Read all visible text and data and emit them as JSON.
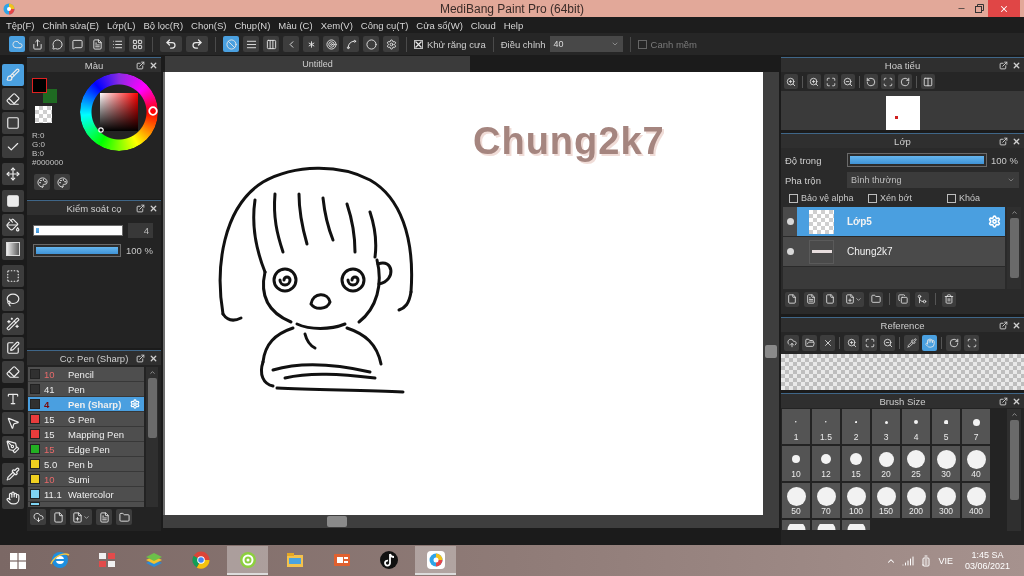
{
  "window": {
    "title": "MediBang Paint Pro (64bit)"
  },
  "menu": [
    "Tệp(F)",
    "Chỉnh sửa(E)",
    "Lớp(L)",
    "Bộ lọc(R)",
    "Chọn(S)",
    "Chụp(N)",
    "Màu (C)",
    "Xem(V)",
    "Công cụ(T)",
    "Cửa sổ(W)",
    "Cloud",
    "Help"
  ],
  "toolbar": {
    "file_buttons": [
      {
        "selected": true
      },
      {
        "selected": false
      },
      {
        "selected": false
      },
      {
        "selected": false
      },
      {
        "selected": false
      },
      {
        "selected": false
      },
      {
        "selected": false
      }
    ],
    "snap_buttons": [
      {
        "selected": true
      },
      {
        "selected": false
      },
      {
        "selected": false
      },
      {
        "selected": false
      },
      {
        "selected": false
      },
      {
        "selected": false
      },
      {
        "selected": false
      },
      {
        "selected": false
      },
      {
        "selected": false
      }
    ],
    "antialias": {
      "label": "Khử răng cưa",
      "checked": true
    },
    "correction": {
      "label": "Điều chỉnh",
      "value": "40"
    },
    "soft_edge": {
      "label": "Canh mềm",
      "checked": false,
      "disabled": true
    }
  },
  "tool_groups": [
    {
      "tools": [
        {
          "selected": true
        },
        {
          "selected": false
        },
        {
          "selected": false
        },
        {
          "selected": false
        }
      ]
    },
    {
      "tools": [
        {
          "selected": false
        }
      ]
    },
    {
      "tools": [
        {
          "selected": false
        },
        {
          "selected": false
        },
        {
          "selected": false
        }
      ]
    },
    {
      "tools": [
        {
          "selected": false
        },
        {
          "selected": false
        },
        {
          "selected": false
        },
        {
          "selected": false
        },
        {
          "selected": false
        }
      ]
    },
    {
      "tools": [
        {
          "selected": false
        },
        {
          "selected": false
        },
        {
          "selected": false
        }
      ]
    },
    {
      "tools": [
        {
          "selected": false
        },
        {
          "selected": false
        }
      ]
    }
  ],
  "color_panel": {
    "title": "Màu",
    "swatches": [
      {
        "color": "#000000"
      },
      {
        "color": "#1f6a22"
      }
    ],
    "channels": [
      "R:0",
      "G:0",
      "B:0"
    ],
    "hex": "#000000"
  },
  "brush_control": {
    "title": "Kiểm soát cọ",
    "size": {
      "level": 0.03,
      "value": "4"
    },
    "opacity": {
      "level": 1,
      "reading": "100 %"
    }
  },
  "brush_panel": {
    "title": "Cọ: Pen (Sharp)",
    "brushes": [
      {
        "color": "#303030",
        "size": {
          "value": "10",
          "highlighted": true
        },
        "name": "Pencil",
        "selected": false
      },
      {
        "color": "#303030",
        "size": {
          "value": "41",
          "highlighted": false
        },
        "name": "Pen",
        "selected": false
      },
      {
        "color": "#303030",
        "size": {
          "value": "4",
          "highlighted": true
        },
        "name": "Pen (Sharp)",
        "selected": true
      },
      {
        "color": "#e83c3c",
        "size": {
          "value": "15",
          "highlighted": false
        },
        "name": "G Pen",
        "selected": false
      },
      {
        "color": "#e83c3c",
        "size": {
          "value": "15",
          "highlighted": false
        },
        "name": "Mapping Pen",
        "selected": false
      },
      {
        "color": "#22b022",
        "size": {
          "value": "15",
          "highlighted": true
        },
        "name": "Edge Pen",
        "selected": false
      },
      {
        "color": "#f0d020",
        "size": {
          "value": "5.0",
          "highlighted": false
        },
        "name": "Pen b",
        "selected": false
      },
      {
        "color": "#f0d020",
        "size": {
          "value": "10",
          "highlighted": true
        },
        "name": "Sumi",
        "selected": false
      },
      {
        "color": "#7fd4f4",
        "size": {
          "value": "11.1",
          "highlighted": false
        },
        "name": "Watercolor",
        "selected": false
      }
    ],
    "cut_row": {
      "color": "#7fd4f4"
    }
  },
  "canvas": {
    "tab": "Untitled",
    "text": "Chung2k7"
  },
  "navigator": {
    "title": "Hoa tiểu"
  },
  "layers_panel": {
    "title": "Lớp",
    "opacity_label": "Độ trong",
    "opacity": {
      "level": 1,
      "reading": "100 %"
    },
    "blend_label": "Pha trộn",
    "blend_value": "Bình thường",
    "options": [
      {
        "label": "Bảo vệ alpha",
        "checked": false
      },
      {
        "label": "Xén bớt",
        "checked": false
      },
      {
        "label": "Khóa",
        "checked": false
      }
    ],
    "layers": [
      {
        "name": "Lớp5",
        "selected": true,
        "visible": true,
        "kind": "blank"
      },
      {
        "name": "Chung2k7",
        "selected": false,
        "visible": true,
        "kind": "text"
      }
    ]
  },
  "reference": {
    "title": "Reference",
    "tools": [
      {
        "selected": false
      },
      {
        "selected": false
      },
      {
        "selected": false
      },
      {
        "selected": false
      },
      {
        "selected": false
      },
      {
        "selected": false
      },
      {
        "selected": false
      },
      {
        "selected": true
      },
      {
        "selected": false
      },
      {
        "selected": false
      }
    ]
  },
  "brush_size": {
    "title": "Brush Size",
    "cells": [
      {
        "kind": "full",
        "label": "1"
      },
      {
        "kind": "full",
        "label": "1.5"
      },
      {
        "kind": "full",
        "label": "2"
      },
      {
        "kind": "full",
        "label": "3"
      },
      {
        "kind": "full",
        "label": "4"
      },
      {
        "kind": "full",
        "label": "5"
      },
      {
        "kind": "full",
        "label": "7"
      },
      {
        "kind": "full",
        "label": "10"
      },
      {
        "kind": "full",
        "label": "12"
      },
      {
        "kind": "full",
        "label": "15"
      },
      {
        "kind": "full",
        "label": "20"
      },
      {
        "kind": "full",
        "label": "25"
      },
      {
        "kind": "full",
        "label": "30"
      },
      {
        "kind": "full",
        "label": "40"
      },
      {
        "kind": "full",
        "label": "50"
      },
      {
        "kind": "full",
        "label": "70"
      },
      {
        "kind": "full",
        "label": "100"
      },
      {
        "kind": "full",
        "label": "150"
      },
      {
        "kind": "full",
        "label": "200"
      },
      {
        "kind": "full",
        "label": "300"
      },
      {
        "kind": "full",
        "label": "400"
      },
      {
        "kind": "cut"
      },
      {
        "kind": "cut"
      },
      {
        "kind": "cut"
      }
    ]
  },
  "taskbar": {
    "apps": [
      {
        "active": false
      },
      {
        "active": false
      },
      {
        "active": false
      },
      {
        "active": false
      },
      {
        "active": true
      },
      {
        "active": false
      },
      {
        "active": false
      },
      {
        "active": false
      },
      {
        "active": true
      }
    ],
    "language": "VIE",
    "time": "1:45 SA",
    "date": "03/06/2021"
  }
}
